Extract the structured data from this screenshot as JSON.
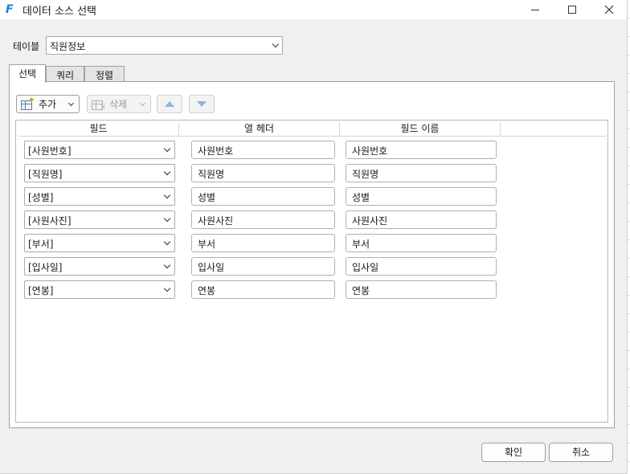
{
  "window": {
    "title": "데이터 소스 선택",
    "app_icon": "F"
  },
  "table": {
    "label": "테이블",
    "selected": "직원정보"
  },
  "tabs": [
    {
      "label": "선택",
      "active": true
    },
    {
      "label": "쿼리",
      "active": false
    },
    {
      "label": "정렬",
      "active": false
    }
  ],
  "toolbar": {
    "add_label": "추가",
    "delete_label": "삭제"
  },
  "grid": {
    "columns": [
      "필드",
      "열 헤더",
      "필드 이름",
      ""
    ],
    "rows": [
      {
        "field": "[사원번호]",
        "header": "사원번호",
        "name": "사원번호"
      },
      {
        "field": "[직원명]",
        "header": "직원명",
        "name": "직원명"
      },
      {
        "field": "[성별]",
        "header": "성별",
        "name": "성별"
      },
      {
        "field": "[사원사진]",
        "header": "사원사진",
        "name": "사원사진"
      },
      {
        "field": "[부서]",
        "header": "부서",
        "name": "부서"
      },
      {
        "field": "[입사일]",
        "header": "입사일",
        "name": "입사일"
      },
      {
        "field": "[연봉]",
        "header": "연봉",
        "name": "연봉"
      }
    ]
  },
  "buttons": {
    "ok": "확인",
    "cancel": "취소"
  },
  "colors": {
    "app_icon": "#1e7fd6",
    "arrow_icon": "#8fb3dc",
    "dialog_bg": "#f0f0f0"
  }
}
